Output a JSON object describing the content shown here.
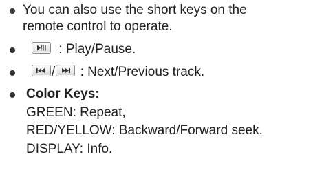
{
  "bullets": {
    "shortkeys": {
      "line1": "You can also use the short keys on the",
      "line2": "remote control to operate."
    },
    "playpause": {
      "icon": "play-pause-key-icon",
      "text": ": Play/Pause."
    },
    "nextprev": {
      "icon_prev": "previous-track-key-icon",
      "separator": "/",
      "icon_next": "next-track-key-icon",
      "text": ": Next/Previous track."
    },
    "colorkeys": {
      "title": "Color Keys:",
      "green": "GREEN: Repeat,",
      "redyellow": "RED/YELLOW: Backward/Forward seek.",
      "display": "DISPLAY: Info."
    }
  }
}
